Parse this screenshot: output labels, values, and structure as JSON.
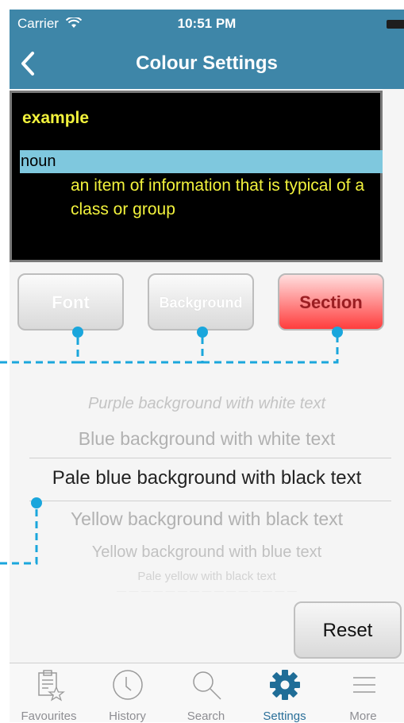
{
  "status_bar": {
    "carrier": "Carrier",
    "time": "10:51 PM"
  },
  "nav": {
    "title": "Colour Settings",
    "back_icon": "chevron-left-icon"
  },
  "preview": {
    "word": "example",
    "part_of_speech": "noun",
    "definition": "an item of information that is typical of a class or group",
    "colors": {
      "background": "#000000",
      "text": "#f2f23c",
      "section": "#7fc8de"
    }
  },
  "segments": {
    "font": "Font",
    "background": "Background",
    "section": "Section",
    "selected": "Section"
  },
  "picker": {
    "options": [
      "Purple background with white text",
      "Blue background with white text",
      "Pale blue background with black text",
      "Yellow background with black text",
      "Yellow background with blue text",
      "Pale yellow with black text"
    ],
    "selected": "Pale blue background with black text"
  },
  "reset_label": "Reset",
  "tabs": [
    {
      "label": "Favourites",
      "icon": "clipboard-star-icon"
    },
    {
      "label": "History",
      "icon": "clock-icon"
    },
    {
      "label": "Search",
      "icon": "magnifier-icon"
    },
    {
      "label": "Settings",
      "icon": "gear-icon"
    },
    {
      "label": "More",
      "icon": "list-icon"
    }
  ],
  "active_tab": "Settings",
  "colors": {
    "accent": "#3e86a8",
    "callout": "#1aa6dc",
    "section_active": "#ff3d3d"
  }
}
